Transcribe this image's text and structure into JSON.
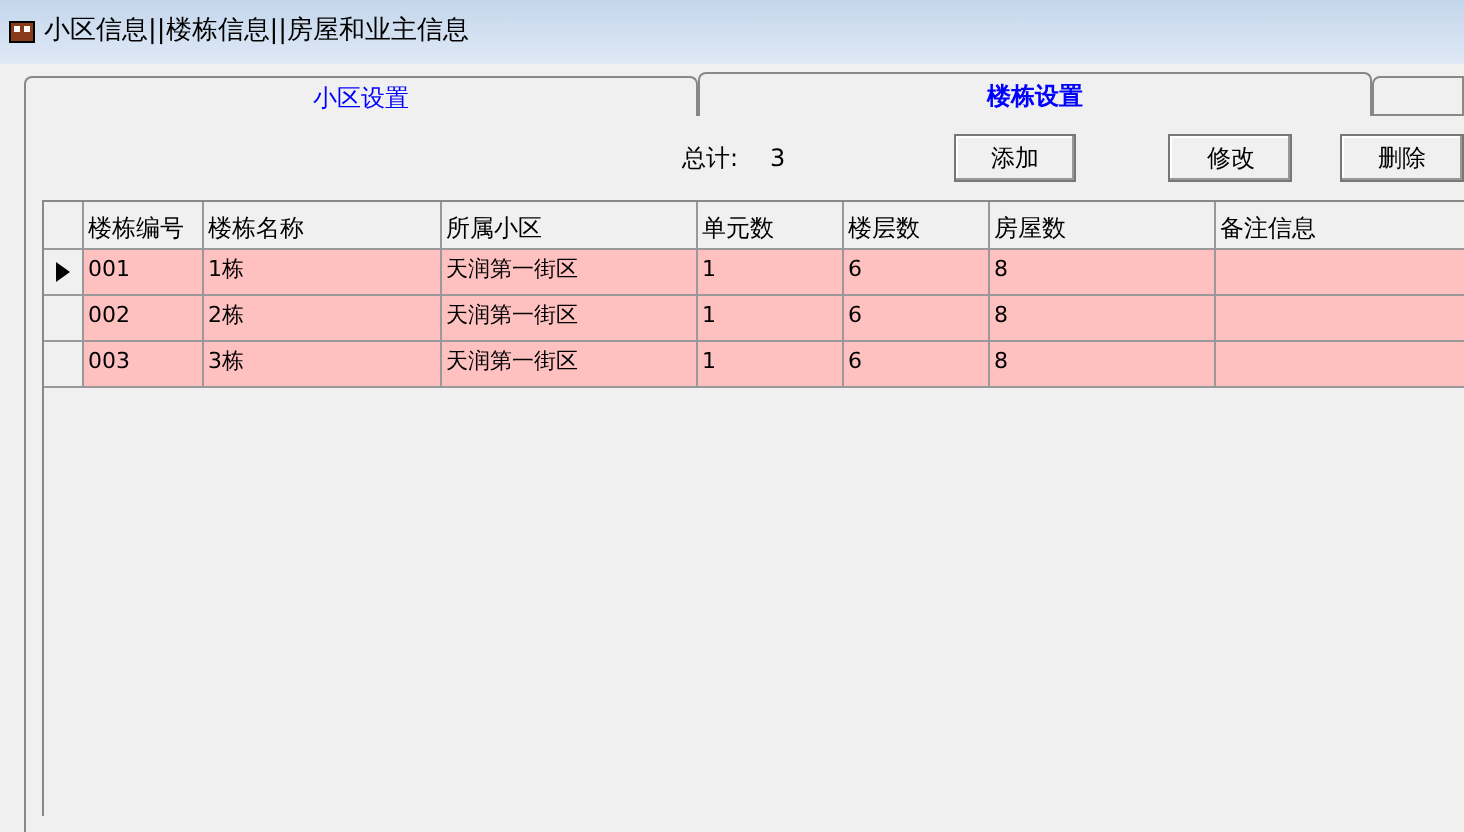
{
  "window": {
    "title": "小区信息||楼栋信息||房屋和业主信息"
  },
  "tabs": [
    {
      "label": "小区设置",
      "selected": false
    },
    {
      "label": "楼栋设置",
      "selected": true
    }
  ],
  "toolbar": {
    "total_label": "总计:",
    "total_value": "3",
    "buttons": [
      "添加",
      "修改",
      "删除"
    ]
  },
  "table": {
    "columns": [
      "楼栋编号",
      "楼栋名称",
      "所属小区",
      "单元数",
      "楼层数",
      "房屋数",
      "备注信息"
    ],
    "rows": [
      {
        "selected": true,
        "cells": [
          "001",
          "1栋",
          "天润第一街区",
          "1",
          "6",
          "8",
          ""
        ]
      },
      {
        "selected": false,
        "cells": [
          "002",
          "2栋",
          "天润第一街区",
          "1",
          "6",
          "8",
          ""
        ]
      },
      {
        "selected": false,
        "cells": [
          "003",
          "3栋",
          "天润第一街区",
          "1",
          "6",
          "8",
          ""
        ]
      }
    ]
  }
}
